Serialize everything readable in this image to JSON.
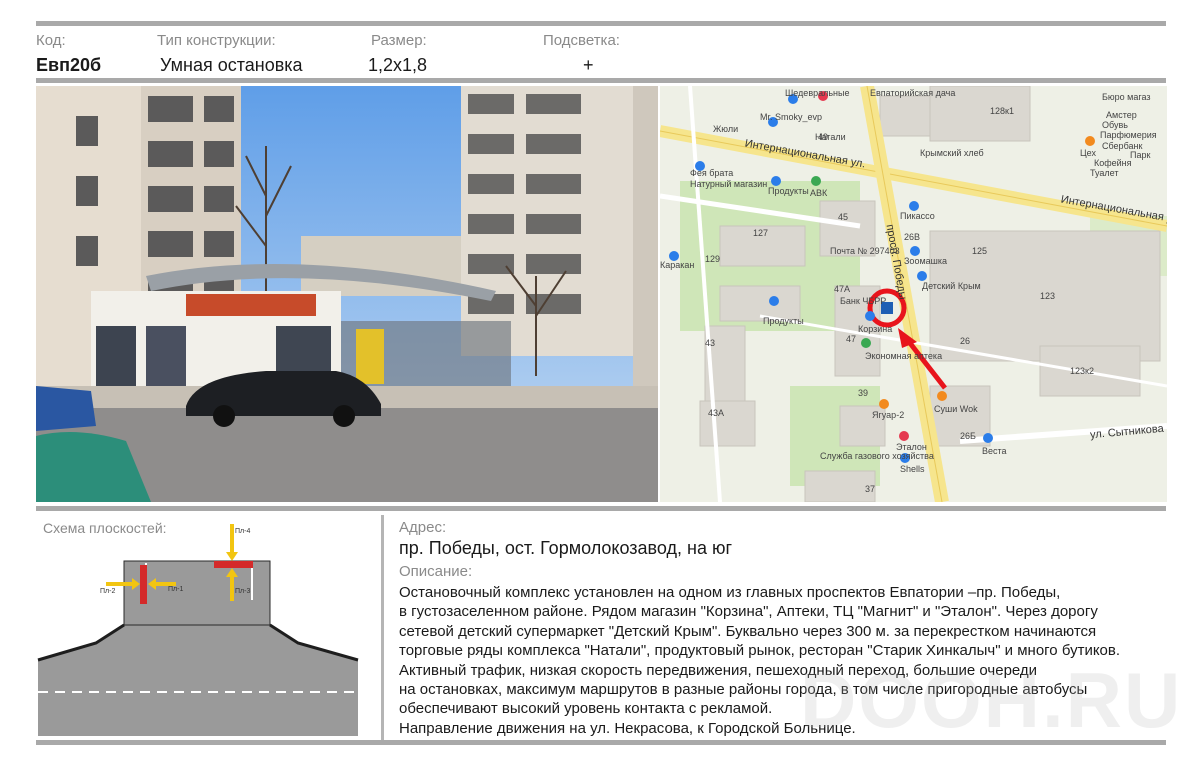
{
  "header": {
    "code_label": "Код:",
    "code_value": "Евп20б",
    "type_label": "Тип конструкции:",
    "type_value": "Умная остановка",
    "size_label": "Размер:",
    "size_value": "1,2х1,8",
    "light_label": "Подсветка:",
    "light_value": "+"
  },
  "map": {
    "streets": [
      "Интернациональная ул.",
      "Интернациональная ул.",
      "просп. Победы",
      "ул. Сытникова"
    ],
    "places": [
      "Шедевральные",
      "Mr. Smoky_evp",
      "Жюли",
      "Натали",
      "Евпаторийская дача",
      "Крымский хлеб",
      "Фея брата",
      "Натурный магазин",
      "Продукты",
      "АВК",
      "Пикассо",
      "Почта № 297403",
      "Зоомашка",
      "Детский Крым",
      "Банк ЧБРР",
      "Корзина",
      "Экономная аптека",
      "Продукты",
      "Каракан",
      "Ягуар-2",
      "Суши Wok",
      "Эталон",
      "Служба газового хозяйства",
      "Shells",
      "Веста",
      "Бюро магаз",
      "Амстер",
      "Обувь",
      "Парфюмерия",
      "Сбербанк",
      "Цех",
      "Парк",
      "Кофейня",
      "Туалет"
    ],
    "numbers": [
      "128к1",
      "49",
      "45",
      "127",
      "129",
      "26В",
      "125",
      "123",
      "47А",
      "43",
      "47",
      "26",
      "123к2",
      "39",
      "43А",
      "26Б",
      "37"
    ]
  },
  "scheme": {
    "title": "Схема плоскостей:",
    "planes": [
      "Пл-1",
      "Пл-2",
      "Пл-3",
      "Пл-4"
    ]
  },
  "address": {
    "label": "Адрес:",
    "value": "пр. Победы, ост. Гормолокозавод, на юг"
  },
  "description": {
    "label": "Описание:",
    "lines": [
      "Остановочный комплекс установлен на одном из главных проспектов Евпатории –пр. Победы,",
      "в густозаселенном районе. Рядом магазин \"Корзина\", Аптеки, ТЦ \"Магнит\" и \"Эталон\". Через дорогу",
      "сетевой детский супермаркет \"Детский Крым\". Буквально через 300 м. за перекрестком начинаются",
      "торговые ряды комплекса \"Натали\", продуктовый рынок, ресторан \"Старик Хинкалыч\" и много бутиков.",
      "Активный трафик, низкая скорость передвижения, пешеходный переход, большие очереди",
      "на остановках, максимум маршрутов в разные районы города, в том числе пригородные автобусы",
      "обеспечивают высокий уровень контакта с рекламой.",
      "Направление движения на ул. Некрасова, к Городской Больнице."
    ]
  },
  "watermark": "DOOH.RU",
  "colors": {
    "rule": "#a9a9a9",
    "marker_ring": "#e8141c",
    "plane_red": "#d42a2a",
    "plane_arrow": "#f2c511",
    "road": "#9a9a9a",
    "map_major_road": "#f6e58d"
  }
}
